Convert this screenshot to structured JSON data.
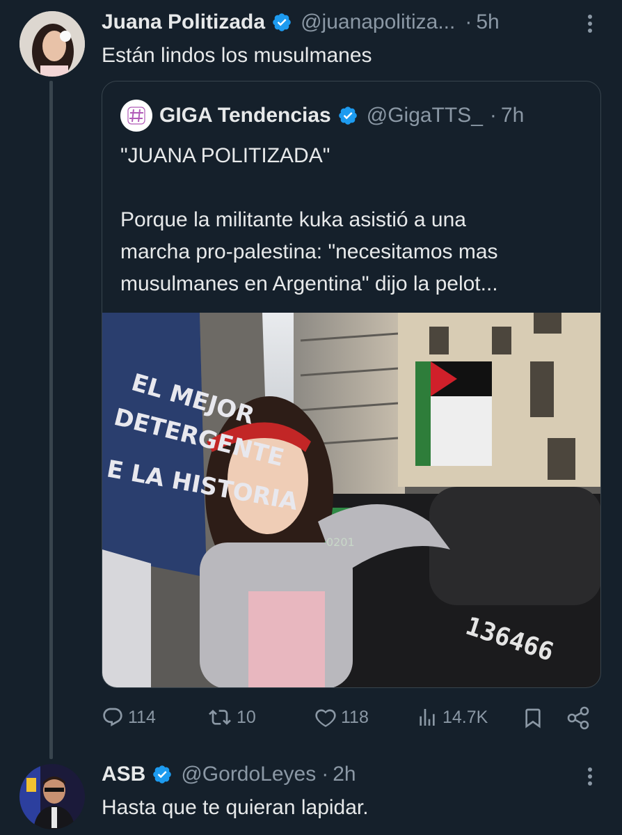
{
  "tweet": {
    "author_name": "Juana Politizada",
    "handle": "@juanapolitiza...",
    "separator": "·",
    "time": "5h",
    "text": "Están lindos los musulmanes",
    "menu_icon": "more-vertical-icon"
  },
  "quote": {
    "author_name": "GIGA Tendencias",
    "handle": "@GigaTTS_",
    "separator": "·",
    "time": "7h",
    "line1": "\"JUANA POLITIZADA\"",
    "line2": "Porque la militante kuka asistió a una",
    "line3": "marcha pro-palestina: \"necesitamos mas",
    "line4": "musulmanes en Argentina\" dijo la pelot...",
    "photo": {
      "wall_text_1": "EL MEJOR",
      "wall_text_2": "DETERGENTE",
      "wall_text_3": "E LA HISTORIA",
      "container_number": "136466",
      "bin_number": "0201"
    }
  },
  "actions": {
    "replies": "114",
    "retweets": "10",
    "likes": "118",
    "views": "14.7K"
  },
  "reply": {
    "author_name": "ASB",
    "handle": "@GordoLeyes",
    "separator": "·",
    "time": "2h",
    "text": "Hasta que te quieran lapidar."
  },
  "colors": {
    "background": "#15202b",
    "verified_blue": "#1d9bf0",
    "muted_text": "#8b98a5",
    "border": "#38444d"
  }
}
